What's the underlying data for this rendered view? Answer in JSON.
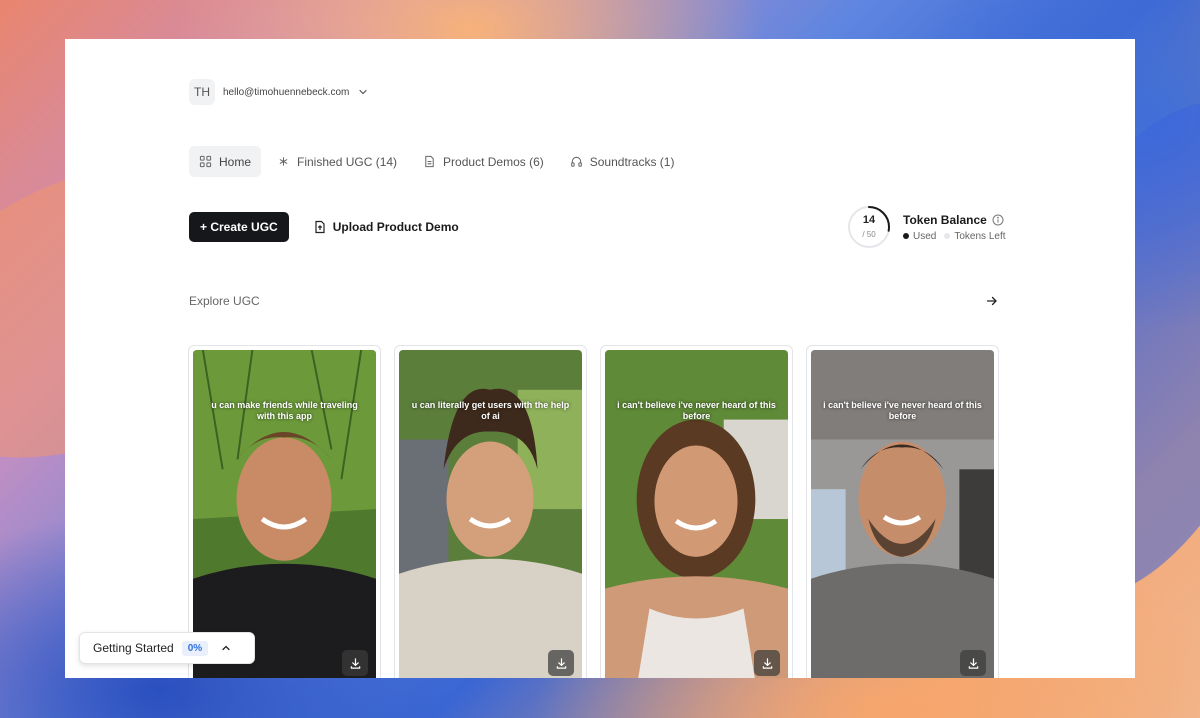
{
  "account": {
    "initials": "TH",
    "email": "hello@timohuennebeck.com"
  },
  "tabs": [
    {
      "label": "Home",
      "icon": "grid-icon",
      "active": true
    },
    {
      "label": "Finished UGC (14)",
      "icon": "asterisk-icon",
      "active": false
    },
    {
      "label": "Product Demos (6)",
      "icon": "document-icon",
      "active": false
    },
    {
      "label": "Soundtracks (1)",
      "icon": "headphones-icon",
      "active": false
    }
  ],
  "actions": {
    "create_label": "+ Create UGC",
    "upload_label": "Upload Product Demo"
  },
  "tokens": {
    "used": "14",
    "total": "/ 50",
    "used_fraction": 0.28,
    "title": "Token Balance",
    "legend_used": "Used",
    "legend_left": "Tokens Left",
    "colors": {
      "used": "#1a1a1a",
      "left": "#e6e7ea"
    }
  },
  "explore": {
    "title": "Explore UGC"
  },
  "cards": [
    {
      "caption": "u can make friends while traveling with this app"
    },
    {
      "caption": "u can literally get users with the help of ai"
    },
    {
      "caption": "i can't believe i've never heard of this before"
    },
    {
      "caption": "i can't believe i've never heard of this before"
    }
  ],
  "getting_started": {
    "label": "Getting Started",
    "progress": "0%"
  },
  "colors": {
    "primary_button": "#16171a",
    "accent_blue": "#2d6fe0"
  }
}
